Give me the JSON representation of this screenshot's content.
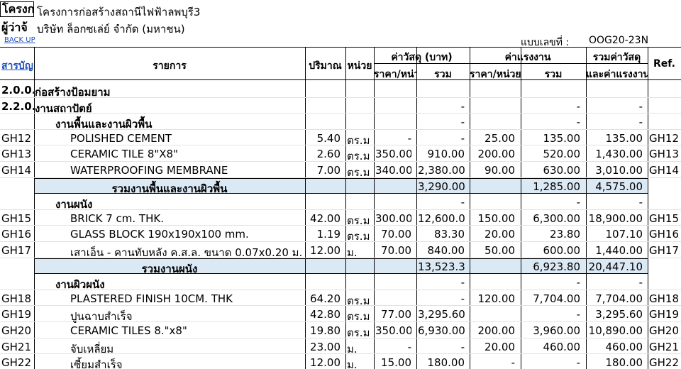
{
  "header": {
    "project_label": "โครงก",
    "project_value": "โครงการก่อสร้างสถานีไฟฟ้าลพบุรี3",
    "contractor_label": "ผู้ว่าจ้",
    "contractor_value": "บริษัท ล็อกซเล่ย์ จำกัด (มหาชน)",
    "backup_link": "BACK UP",
    "form_no_label": "แบบเลขที่ :",
    "form_no_value": "OOG20-23N",
    "index_link": "สารบัญ"
  },
  "table_header": {
    "item": "รายการ",
    "quantity": "ปริมาณ",
    "unit": "หน่วย",
    "material_cost": "ค่าวัสดุ (บาท)",
    "labor_cost": "ค่าแรงงาน",
    "total_cost_line1": "รวมค่าวัสดุ",
    "total_cost_line2": "และค่าแรงงาน",
    "unit_price": "ราคา/หน่วย",
    "total": "รวม",
    "unit_price_labor": "ราคา/หน่วย",
    "total_labor": "รวม",
    "ref": "Ref."
  },
  "rows": [
    {
      "code": "2.0.0.0",
      "name": "ก่อสร้างป้อมยาม",
      "bold": true,
      "indent": 0,
      "qty": "",
      "unit": "",
      "mp": "",
      "mt": "",
      "lp": "",
      "lt": "",
      "tot": "",
      "ref": ""
    },
    {
      "code": "2.2.0.0",
      "name": "งานสถาปัตย์",
      "bold": true,
      "indent": 0,
      "qty": "",
      "unit": "",
      "mp": "",
      "mt": "-",
      "lp": "",
      "lt": "-",
      "tot": "-",
      "ref": ""
    },
    {
      "code": "",
      "name": "งานพื้นและงานผิวพื้น",
      "bold": true,
      "indent": 1,
      "qty": "",
      "unit": "",
      "mp": "",
      "mt": "-",
      "lp": "",
      "lt": "-",
      "tot": "-",
      "ref": ""
    },
    {
      "code": "GH12",
      "name": "POLISHED CEMENT",
      "bold": false,
      "indent": 2,
      "qty": "5.40",
      "unit": "ตร.ม.",
      "mp": "-",
      "mt": "-",
      "lp": "25.00",
      "lt": "135.00",
      "tot": "135.00",
      "ref": "GH12"
    },
    {
      "code": "GH13",
      "name": "CERAMIC TILE 8\"X8\"",
      "bold": false,
      "indent": 2,
      "qty": "2.60",
      "unit": "ตร.ม.",
      "mp": "350.00",
      "mt": "910.00",
      "lp": "200.00",
      "lt": "520.00",
      "tot": "1,430.00",
      "ref": "GH13"
    },
    {
      "code": "GH14",
      "name": "WATERPROOFING MEMBRANE",
      "bold": false,
      "indent": 2,
      "qty": "7.00",
      "unit": "ตร.ม.",
      "mp": "340.00",
      "mt": "2,380.00",
      "lp": "90.00",
      "lt": "630.00",
      "tot": "3,010.00",
      "ref": "GH14"
    },
    {
      "code": "",
      "name": "รวมงานพื้นและงานผิวพื้น",
      "subtotal": true,
      "qty": "",
      "unit": "",
      "mp": "",
      "mt": "3,290.00",
      "lp": "",
      "lt": "1,285.00",
      "tot": "4,575.00",
      "ref": ""
    },
    {
      "code": "",
      "name": "งานผนัง",
      "bold": true,
      "indent": 1,
      "qty": "",
      "unit": "",
      "mp": "",
      "mt": "-",
      "lp": "",
      "lt": "-",
      "tot": "-",
      "ref": ""
    },
    {
      "code": "GH15",
      "name": "BRICK 7 cm. THK.",
      "bold": false,
      "indent": 2,
      "qty": "42.00",
      "unit": "ตร.ม.",
      "mp": "300.00",
      "mt": "12,600.00",
      "lp": "150.00",
      "lt": "6,300.00",
      "tot": "18,900.00",
      "ref": "GH15"
    },
    {
      "code": "GH16",
      "name": "GLASS BLOCK 190x190x100 mm.",
      "bold": false,
      "indent": 2,
      "qty": "1.19",
      "unit": "ตร.ม.",
      "mp": "70.00",
      "mt": "83.30",
      "lp": "20.00",
      "lt": "23.80",
      "tot": "107.10",
      "ref": "GH16"
    },
    {
      "code": "GH17",
      "name": "เสาเอ็น - คานทับหลัง ค.ส.ล.  ขนาด 0.07x0.20 ม.",
      "bold": false,
      "indent": 2,
      "qty": "12.00",
      "unit": "ม.",
      "mp": "70.00",
      "mt": "840.00",
      "lp": "50.00",
      "lt": "600.00",
      "tot": "1,440.00",
      "ref": "GH17"
    },
    {
      "code": "",
      "name": "รวมงานผนัง",
      "subtotal": true,
      "qty": "",
      "unit": "",
      "mp": "",
      "mt": "13,523.30",
      "lp": "",
      "lt": "6,923.80",
      "tot": "20,447.10",
      "ref": ""
    },
    {
      "code": "",
      "name": "งานผิวผนัง",
      "bold": true,
      "indent": 1,
      "qty": "",
      "unit": "",
      "mp": "",
      "mt": "-",
      "lp": "",
      "lt": "-",
      "tot": "-",
      "ref": ""
    },
    {
      "code": "GH18",
      "name": "PLASTERED FINISH 10CM. THK",
      "bold": false,
      "indent": 2,
      "qty": "64.20",
      "unit": "ตร.ม.",
      "mp": "",
      "mt": "-",
      "lp": "120.00",
      "lt": "7,704.00",
      "tot": "7,704.00",
      "ref": "GH18"
    },
    {
      "code": "GH19",
      "name": "ปูนฉาบสำเร็จ",
      "bold": false,
      "indent": 2,
      "qty": "42.80",
      "unit": "ตร.ม.",
      "mp": "77.00",
      "mt": "3,295.60",
      "lp": "",
      "lt": "-",
      "tot": "3,295.60",
      "ref": "GH19"
    },
    {
      "code": "GH20",
      "name": "CERAMIC TILES 8.\"x8\"",
      "bold": false,
      "indent": 2,
      "qty": "19.80",
      "unit": "ตร.ม.",
      "mp": "350.00",
      "mt": "6,930.00",
      "lp": "200.00",
      "lt": "3,960.00",
      "tot": "10,890.00",
      "ref": "GH20"
    },
    {
      "code": "GH21",
      "name": "จับเหลี่ยม",
      "bold": false,
      "indent": 2,
      "qty": "23.00",
      "unit": "ม.",
      "mp": "-",
      "mt": "-",
      "lp": "20.00",
      "lt": "460.00",
      "tot": "460.00",
      "ref": "GH21"
    },
    {
      "code": "GH22",
      "name": "เซี้ยมสำเร็จ",
      "bold": false,
      "indent": 2,
      "qty": "12.00",
      "unit": "ม.",
      "mp": "15.00",
      "mt": "180.00",
      "lp": "-",
      "lt": "-",
      "tot": "180.00",
      "ref": "GH22"
    }
  ]
}
